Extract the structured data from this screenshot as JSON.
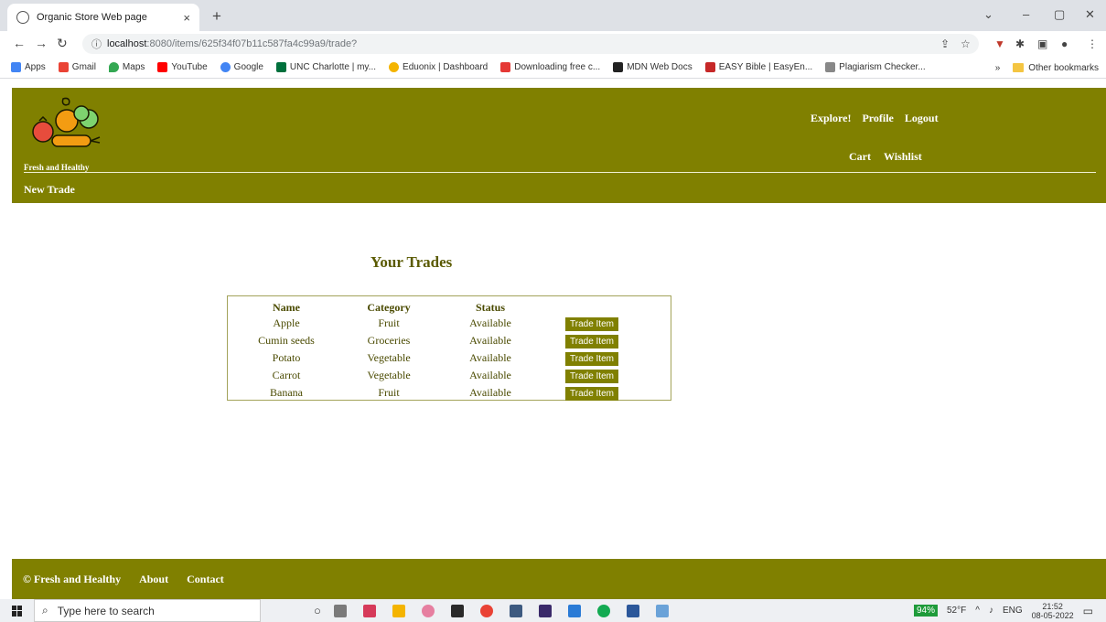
{
  "browser": {
    "tab_title": "Organic Store Web page",
    "tab_close": "×",
    "new_tab": "+",
    "url_host": "localhost",
    "url_path": ":8080/items/625f34f07b11c587fa4c99a9/trade?",
    "bookmarks": [
      {
        "label": "Apps",
        "color": "#4285f4"
      },
      {
        "label": "Gmail",
        "color": "#ea4335"
      },
      {
        "label": "Maps",
        "color": "#34a853"
      },
      {
        "label": "YouTube",
        "color": "#ff0000"
      },
      {
        "label": "Google",
        "color": "#4285f4"
      },
      {
        "label": "UNC Charlotte | my...",
        "color": "#00703c"
      },
      {
        "label": "Eduonix | Dashboard",
        "color": "#f4b400"
      },
      {
        "label": "Downloading free c...",
        "color": "#e53935"
      },
      {
        "label": "MDN Web Docs",
        "color": "#222222"
      },
      {
        "label": "EASY Bible | EasyEn...",
        "color": "#c62828"
      },
      {
        "label": "Plagiarism Checker...",
        "color": "#888888"
      }
    ],
    "bookmarks_overflow": "»",
    "other_bookmarks": "Other bookmarks"
  },
  "site": {
    "brand": "Fresh and Healthy",
    "nav_top": [
      {
        "label": "Explore!",
        "name": "nav-explore-link"
      },
      {
        "label": "Profile",
        "name": "nav-profile-link"
      },
      {
        "label": "Logout",
        "name": "nav-logout-link"
      }
    ],
    "nav_bottom": [
      {
        "label": "Cart",
        "name": "nav-cart-link"
      },
      {
        "label": "Wishlist",
        "name": "nav-wishlist-link"
      }
    ],
    "new_trade": "New Trade"
  },
  "main": {
    "title": "Your Trades",
    "headers": [
      "Name",
      "Category",
      "Status",
      ""
    ],
    "rows": [
      {
        "name": "Apple",
        "category": "Fruit",
        "status": "Available",
        "action": "Trade Item"
      },
      {
        "name": "Cumin seeds",
        "category": "Groceries",
        "status": "Available",
        "action": "Trade Item"
      },
      {
        "name": "Potato",
        "category": "Vegetable",
        "status": "Available",
        "action": "Trade Item"
      },
      {
        "name": "Carrot",
        "category": "Vegetable",
        "status": "Available",
        "action": "Trade Item"
      },
      {
        "name": "Banana",
        "category": "Fruit",
        "status": "Available",
        "action": "Trade Item"
      }
    ]
  },
  "footer": {
    "copyright": "© Fresh and Healthy",
    "about": "About",
    "contact": "Contact"
  },
  "taskbar": {
    "search_placeholder": "Type here to search",
    "battery": "94%",
    "weather": "52°F",
    "lang": "ENG",
    "time": "21:52",
    "date": "08-05-2022"
  },
  "colors": {
    "accent": "#808000"
  }
}
